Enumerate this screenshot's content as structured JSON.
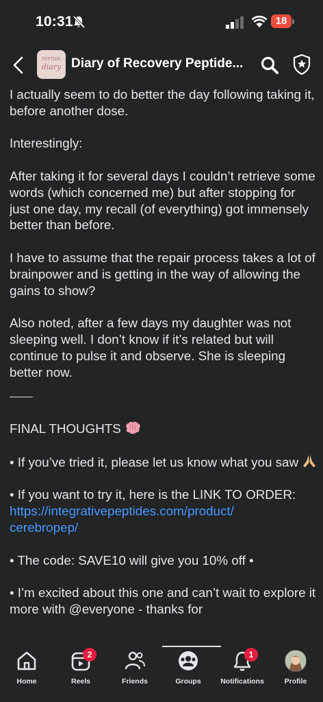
{
  "status_bar": {
    "time": "10:31",
    "battery": "18"
  },
  "header": {
    "group_title": "Diary of Recovery Peptide...",
    "avatar_lines": [
      "PEPTIDE",
      "diary"
    ]
  },
  "post": {
    "p1": "I actually seem to do better the day following taking it, before another dose.",
    "p2": "Interestingly:",
    "p3": "After taking it for several days I couldn’t retrieve some words (which concerned me) but after stopping for just one day, my recall (of everything) got immensely better than before.",
    "p4": "I have to assume that the repair process takes a lot of brainpower and is getting in the way of allowing the gains to show?",
    "p5": "Also noted, after a few days my daughter was not sleeping well. I don’t know if it’s related but will continue to pulse it and observe. She is sleeping better now.",
    "final_heading": "FINAL THOUGHTS",
    "b1": "• If you’ve tried it, please let us know what you saw",
    "b2": "• If you want to try it, here is the LINK TO ORDER:",
    "link": "https://integrativepeptides.com/product/cerebropep/",
    "link_line1": "https://integrativepeptides.com/product/",
    "link_line2": "cerebropep/",
    "b3": "• The code: SAVE10 will give you 10% off •",
    "b4": "• I’m excited about this one and can’t wait to explore it more with @everyone - thanks for"
  },
  "tabs": [
    {
      "label": "Home",
      "icon": "home-icon"
    },
    {
      "label": "Reels",
      "icon": "reels-icon",
      "badge": "2"
    },
    {
      "label": "Friends",
      "icon": "friends-icon"
    },
    {
      "label": "Groups",
      "icon": "groups-icon"
    },
    {
      "label": "Notifications",
      "icon": "bell-icon",
      "badge": "1"
    },
    {
      "label": "Profile",
      "icon": "profile-avatar"
    }
  ],
  "colors": {
    "background": "#232425",
    "text": "#e4e6eb",
    "link": "#4599ff",
    "badge": "#e41e3f",
    "battery": "#eb4d3d"
  }
}
